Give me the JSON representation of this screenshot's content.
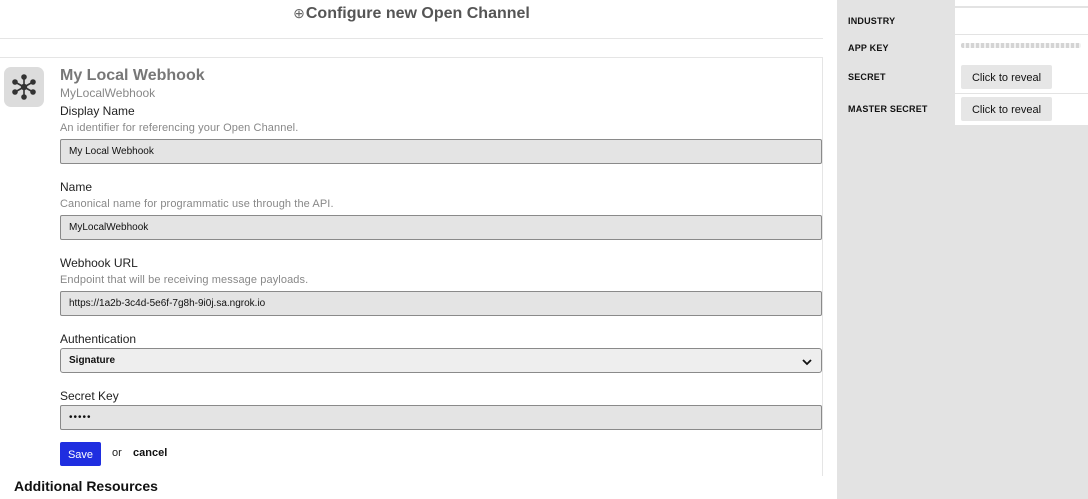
{
  "header": {
    "plus_icon": "⊕",
    "title": "Configure new Open Channel"
  },
  "app": {
    "icon": "hub-asterisk-icon",
    "name": "My Local Webhook",
    "slug": "MyLocalWebhook"
  },
  "form": {
    "display_name": {
      "label": "Display Name",
      "help": "An identifier for referencing your Open Channel.",
      "value": "My Local Webhook"
    },
    "name": {
      "label": "Name",
      "help": "Canonical name for programmatic use through the API.",
      "value": "MyLocalWebhook"
    },
    "webhook_url": {
      "label": "Webhook URL",
      "help": "Endpoint that will be receiving message payloads.",
      "value": "https://1a2b-3c4d-5e6f-7g8h-9i0j.sa.ngrok.io"
    },
    "authentication": {
      "label": "Authentication",
      "value": "Signature"
    },
    "secret_key": {
      "label": "Secret Key",
      "value": "•••••"
    },
    "save_label": "Save",
    "or_label": "or",
    "cancel_label": "cancel"
  },
  "resources": {
    "heading": "Additional Resources"
  },
  "side_panel": {
    "industry": {
      "label": "INDUSTRY",
      "value": ""
    },
    "app_key": {
      "label": "APP KEY"
    },
    "secret": {
      "label": "SECRET",
      "button": "Click to reveal"
    },
    "master_secret": {
      "label": "MASTER SECRET",
      "button": "Click to reveal"
    }
  },
  "colors": {
    "primary_button": "#1f2ee0",
    "panel_bg": "#e3e3e3",
    "input_bg": "#e4e4e4"
  }
}
